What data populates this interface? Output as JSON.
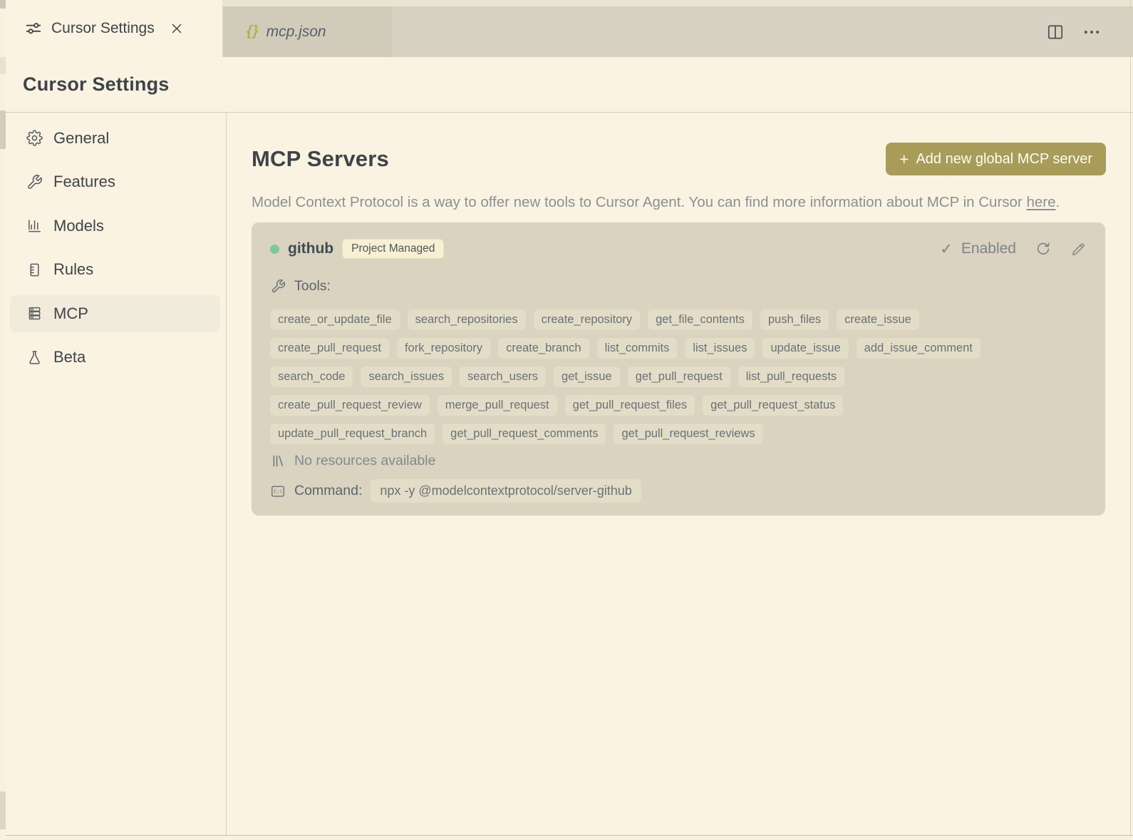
{
  "colors": {
    "accent_button": "#a89c58",
    "status_green": "#7cc99a",
    "braces_icon": "#b2b442",
    "background": "#faf3e1",
    "card": "#d9d3bf",
    "chip": "#e3ddc7"
  },
  "tabs": {
    "active": {
      "label": "Cursor Settings"
    },
    "preview": {
      "icon_text": "{}",
      "label": "mcp.json"
    }
  },
  "header": {
    "title": "Cursor Settings"
  },
  "sidebar": {
    "items": [
      {
        "label": "General"
      },
      {
        "label": "Features"
      },
      {
        "label": "Models"
      },
      {
        "label": "Rules"
      },
      {
        "label": "MCP",
        "selected": true
      },
      {
        "label": "Beta"
      }
    ]
  },
  "main": {
    "title": "MCP Servers",
    "add_button": {
      "plus": "+",
      "label": "Add new global MCP server"
    },
    "description_before_link": "Model Context Protocol is a way to offer new tools to Cursor Agent. You can find more information about MCP in Cursor ",
    "description_link": "here",
    "description_after_link": "."
  },
  "server_card": {
    "name": "github",
    "badge": "Project Managed",
    "status": {
      "check": "✓",
      "label": "Enabled"
    },
    "tools_label": "Tools:",
    "tool_rows": [
      [
        "create_or_update_file",
        "search_repositories",
        "create_repository",
        "get_file_contents",
        "push_files",
        "create_issue"
      ],
      [
        "create_pull_request",
        "fork_repository",
        "create_branch",
        "list_commits",
        "list_issues",
        "update_issue",
        "add_issue_comment"
      ],
      [
        "search_code",
        "search_issues",
        "search_users",
        "get_issue",
        "get_pull_request",
        "list_pull_requests"
      ],
      [
        "create_pull_request_review",
        "merge_pull_request",
        "get_pull_request_files",
        "get_pull_request_status"
      ],
      [
        "update_pull_request_branch",
        "get_pull_request_comments",
        "get_pull_request_reviews"
      ]
    ],
    "resources_text": "No resources available",
    "command_label": "Command:",
    "command_value": "npx -y @modelcontextprotocol/server-github"
  }
}
